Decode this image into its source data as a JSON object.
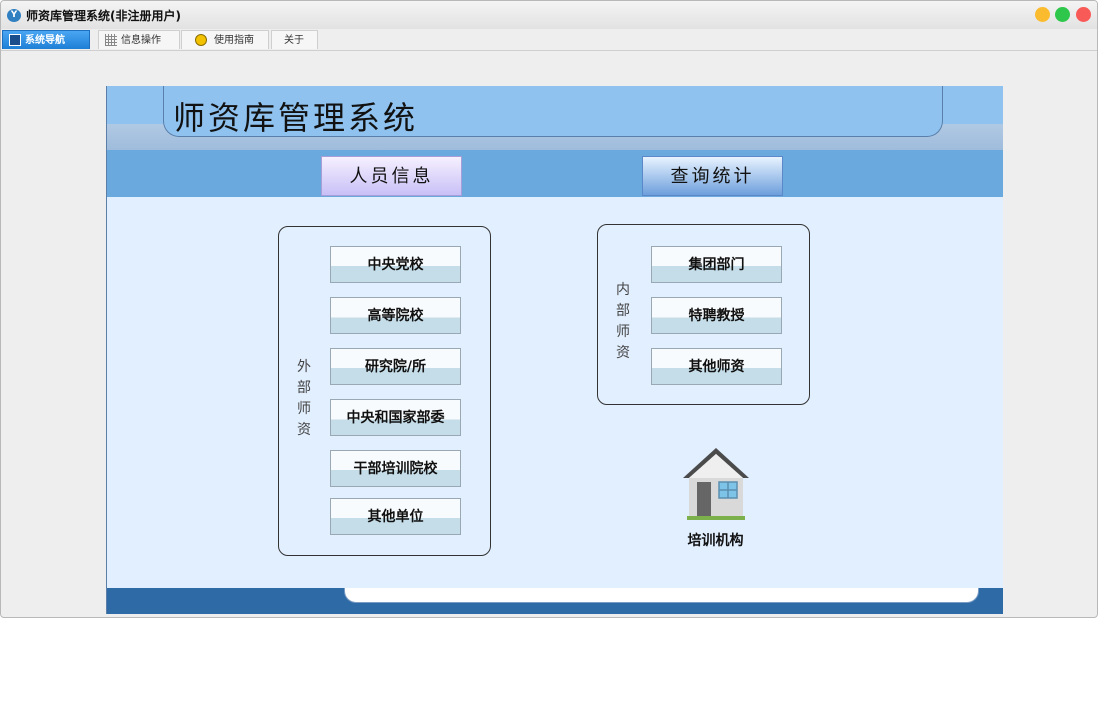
{
  "window": {
    "title": "师资库管理系统(非注册用户)",
    "app_icon": "app-logo-icon"
  },
  "tabs": [
    {
      "label": "系统导航",
      "icon": "monitor-icon",
      "active": true
    },
    {
      "label": "信息操作",
      "icon": "grid-icon",
      "active": false
    },
    {
      "label": "使用指南",
      "icon": "guide-icon",
      "active": false
    },
    {
      "label": "关于",
      "icon": "",
      "active": false
    }
  ],
  "banner": {
    "title": "师资库管理系统"
  },
  "nav": {
    "info_label": "人员信息",
    "query_label": "查询统计"
  },
  "external": {
    "label": "外部师资",
    "buttons": [
      "中央党校",
      "高等院校",
      "研究院/所",
      "中央和国家部委",
      "干部培训院校",
      "其他单位"
    ]
  },
  "internal": {
    "label": "内部师资",
    "buttons": [
      "集团部门",
      "特聘教授",
      "其他师资"
    ]
  },
  "training": {
    "label": "培训机构",
    "icon": "house-icon"
  },
  "colors": {
    "accent": "#2e6aa6",
    "nav_bar": "#69a9de",
    "panel": "#e2efff"
  }
}
